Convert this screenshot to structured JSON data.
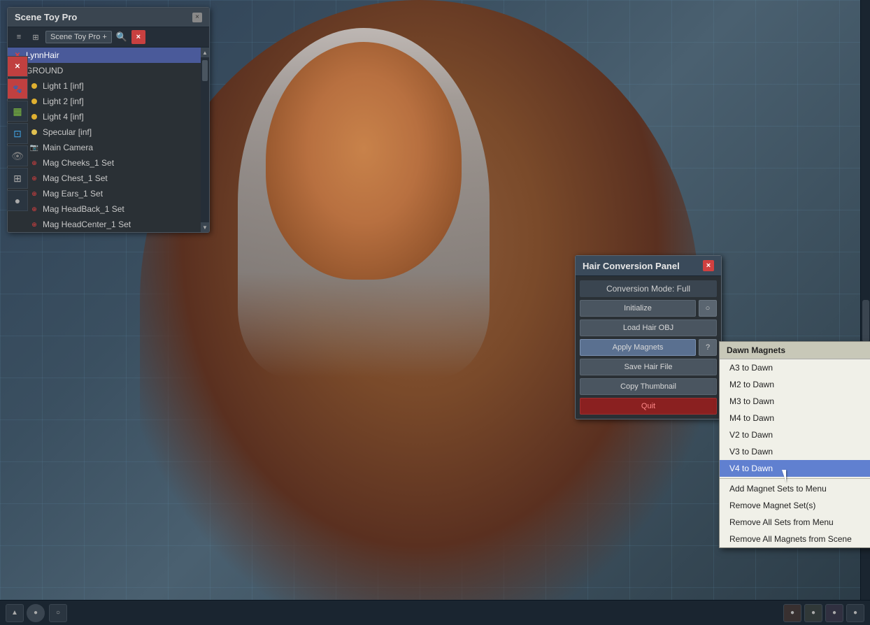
{
  "app": {
    "title": "Scene Toy Pro"
  },
  "sceneToyPanel": {
    "title": "Scene Toy Pro",
    "close_btn": "×",
    "toolbar": {
      "dropdown_label": "Scene Toy Pro +",
      "search_placeholder": "Search",
      "close_label": "×"
    },
    "items": [
      {
        "id": "lynnhair",
        "label": "LynnHair",
        "icon_type": "red_x",
        "selected": true,
        "indent": 1
      },
      {
        "id": "ground",
        "label": "GROUND",
        "icon_type": "orange_dot",
        "selected": false,
        "indent": 1
      },
      {
        "id": "light1",
        "label": "Light 1 [inf]",
        "icon_type": "yellow_dot",
        "selected": false,
        "indent": 2
      },
      {
        "id": "light2",
        "label": "Light 2 [inf]",
        "icon_type": "yellow_dot",
        "selected": false,
        "indent": 2
      },
      {
        "id": "light4",
        "label": "Light 4 [inf]",
        "icon_type": "yellow_dot",
        "selected": false,
        "indent": 2
      },
      {
        "id": "specular",
        "label": "Specular [inf]",
        "icon_type": "yellow_dot",
        "selected": false,
        "indent": 2
      },
      {
        "id": "maincamera",
        "label": "Main Camera",
        "icon_type": "camera",
        "selected": false,
        "indent": 2
      },
      {
        "id": "magcheeks",
        "label": "Mag Cheeks_1 Set",
        "icon_type": "magnet",
        "selected": false,
        "indent": 2
      },
      {
        "id": "magchest",
        "label": "Mag Chest_1 Set",
        "icon_type": "magnet",
        "selected": false,
        "indent": 2
      },
      {
        "id": "magears",
        "label": "Mag Ears_1 Set",
        "icon_type": "magnet",
        "selected": false,
        "indent": 2
      },
      {
        "id": "magheadback",
        "label": "Mag HeadBack_1 Set",
        "icon_type": "magnet",
        "selected": false,
        "indent": 2
      },
      {
        "id": "magheadcenter",
        "label": "Mag HeadCenter_1 Set",
        "icon_type": "magnet",
        "selected": false,
        "indent": 2
      }
    ]
  },
  "hairPanel": {
    "title": "Hair Conversion Panel",
    "close_btn": "×",
    "conversion_mode_label": "Conversion Mode: Full",
    "btn_initialize": "Initialize",
    "btn_load_hair_obj": "Load Hair OBJ",
    "btn_apply_magnets": "Apply Magnets",
    "btn_save_hair_file": "Save Hair File",
    "btn_copy_thumbnail": "Copy Thumbnail",
    "btn_quit": "Quit"
  },
  "dawnMagnets": {
    "header": "Dawn Magnets",
    "items": [
      {
        "id": "a3dawn",
        "label": "A3 to Dawn",
        "highlighted": false
      },
      {
        "id": "m2dawn",
        "label": "M2 to Dawn",
        "highlighted": false
      },
      {
        "id": "m3dawn",
        "label": "M3 to Dawn",
        "highlighted": false
      },
      {
        "id": "m4dawn",
        "label": "M4 to Dawn",
        "highlighted": false
      },
      {
        "id": "v2dawn",
        "label": "V2 to Dawn",
        "highlighted": false
      },
      {
        "id": "v3dawn",
        "label": "V3 to Dawn",
        "highlighted": false
      },
      {
        "id": "v4dawn",
        "label": "V4 to Dawn",
        "highlighted": true
      }
    ],
    "divider": true,
    "extra_items": [
      {
        "id": "add-magnet-sets",
        "label": "Add Magnet Sets to Menu",
        "highlighted": false
      },
      {
        "id": "remove-magnet-set",
        "label": "Remove Magnet Set(s)",
        "highlighted": false
      },
      {
        "id": "remove-all-sets",
        "label": "Remove All Sets from Menu",
        "highlighted": false
      },
      {
        "id": "remove-all-magnets",
        "label": "Remove All Magnets from Scene",
        "highlighted": false
      }
    ]
  },
  "taskbar": {
    "left_btn_label": "▲",
    "circle_btn_label": "●",
    "right_icon_label": "○"
  },
  "colors": {
    "selected_item_bg": "#4a5a9a",
    "highlighted_menu_bg": "#6080d0",
    "red_btn": "#8a2020",
    "panel_bg": "#2a3035",
    "toolbar_bg": "#3a4550"
  }
}
